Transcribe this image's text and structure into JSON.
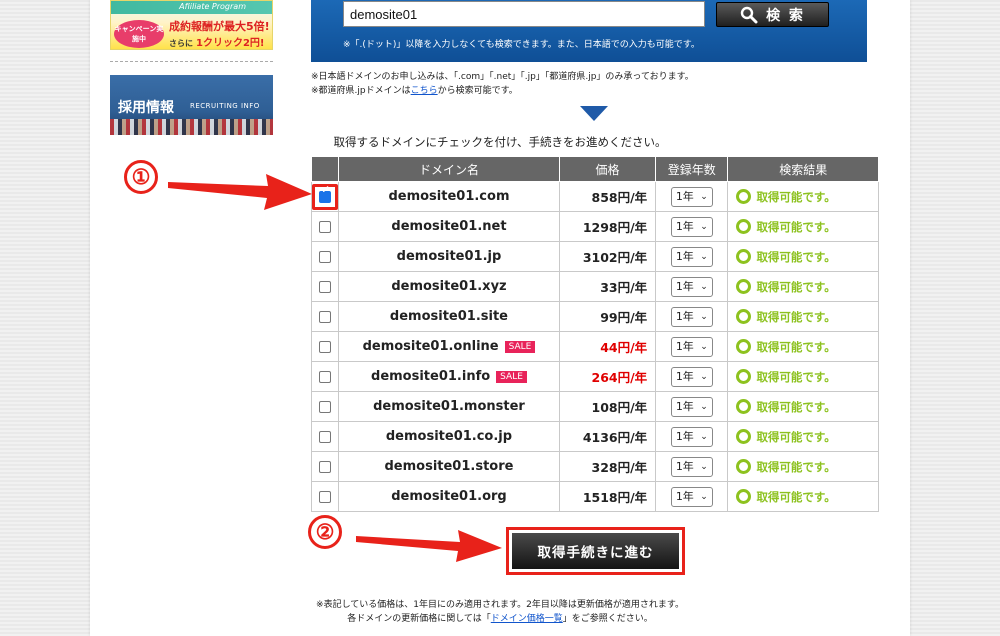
{
  "sidebar": {
    "affiliate_banner": {
      "subtitle": "Afiiliate Program",
      "campaign": "キャンペーン実施中",
      "line1": "成約報酬が最大5倍!",
      "line2_small": "さらに",
      "line2": "1クリック2円!"
    },
    "recruit_banner": {
      "title": "採用情報",
      "subtitle": "RECRUITING INFO"
    }
  },
  "search": {
    "input_value": "demosite01",
    "button_label": "検 索",
    "note": "※「.(ドット)」以降を入力しなくても検索できます。また、日本語での入力も可能です。"
  },
  "notes": {
    "line1": "※日本語ドメインのお申し込みは、「.com」「.net」「.jp」「都道府県.jp」のみ承っております。",
    "line2_pre": "※都道府県.jpドメインは",
    "line2_link": "こちら",
    "line2_post": "から検索可能です。"
  },
  "instruction": "取得するドメインにチェックを付け、手続きをお進めください。",
  "table": {
    "headers": {
      "name": "ドメイン名",
      "price": "価格",
      "years": "登録年数",
      "result": "検索結果"
    },
    "sale_label": "SALE",
    "rows": [
      {
        "checked": true,
        "name": "demosite01.com",
        "price": "858円/年",
        "sale": false,
        "years": "1年",
        "result": "取得可能です。"
      },
      {
        "checked": false,
        "name": "demosite01.net",
        "price": "1298円/年",
        "sale": false,
        "years": "1年",
        "result": "取得可能です。"
      },
      {
        "checked": false,
        "name": "demosite01.jp",
        "price": "3102円/年",
        "sale": false,
        "years": "1年",
        "result": "取得可能です。"
      },
      {
        "checked": false,
        "name": "demosite01.xyz",
        "price": "33円/年",
        "sale": false,
        "years": "1年",
        "result": "取得可能です。"
      },
      {
        "checked": false,
        "name": "demosite01.site",
        "price": "99円/年",
        "sale": false,
        "years": "1年",
        "result": "取得可能です。"
      },
      {
        "checked": false,
        "name": "demosite01.online",
        "price": "44円/年",
        "sale": true,
        "years": "1年",
        "result": "取得可能です。"
      },
      {
        "checked": false,
        "name": "demosite01.info",
        "price": "264円/年",
        "sale": true,
        "years": "1年",
        "result": "取得可能です。"
      },
      {
        "checked": false,
        "name": "demosite01.monster",
        "price": "108円/年",
        "sale": false,
        "years": "1年",
        "result": "取得可能です。"
      },
      {
        "checked": false,
        "name": "demosite01.co.jp",
        "price": "4136円/年",
        "sale": false,
        "years": "1年",
        "result": "取得可能です。"
      },
      {
        "checked": false,
        "name": "demosite01.store",
        "price": "328円/年",
        "sale": false,
        "years": "1年",
        "result": "取得可能です。"
      },
      {
        "checked": false,
        "name": "demosite01.org",
        "price": "1518円/年",
        "sale": false,
        "years": "1年",
        "result": "取得可能です。"
      }
    ]
  },
  "annotations": {
    "step1": "①",
    "step2": "②"
  },
  "proceed_button": "取得手続きに進む",
  "footnote": {
    "line1": "※表記している価格は、1年目にのみ適用されます。2年目以降は更新価格が適用されます。",
    "line2_pre": "各ドメインの更新価格に関しては「",
    "line2_link": "ドメイン価格一覧",
    "line2_post": "」をご参照ください。"
  },
  "colors": {
    "accent_red": "#e8221a",
    "header_blue": "#1c69b6",
    "ok_green": "#8dc21f",
    "sale_pink": "#e8235a",
    "sale_price": "#e00000"
  }
}
